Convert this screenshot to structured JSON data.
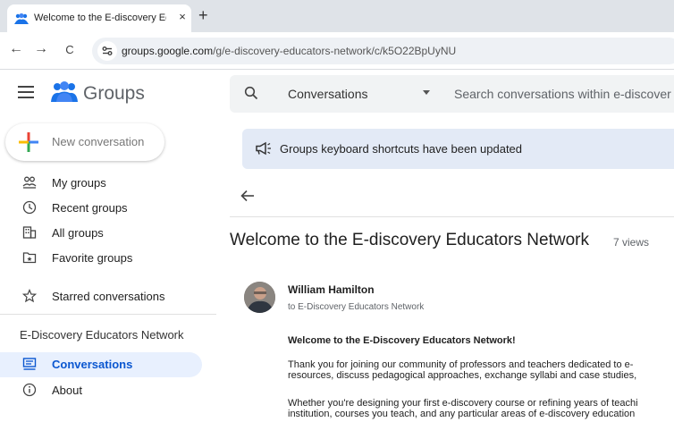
{
  "browser": {
    "tab_title": "Welcome to the E-discovery Ed",
    "tab_close": "×",
    "new_tab": "+",
    "back": "←",
    "forward": "→",
    "reload": "C",
    "url_host": "groups.google.com",
    "url_path": "/g/e-discovery-educators-network/c/k5O22BpUyNU"
  },
  "app": {
    "name": "Groups",
    "new_conversation": "New conversation"
  },
  "sidebar": {
    "items": [
      {
        "label": "My groups",
        "icon": "people-icon"
      },
      {
        "label": "Recent groups",
        "icon": "clock-icon"
      },
      {
        "label": "All groups",
        "icon": "building-icon"
      },
      {
        "label": "Favorite groups",
        "icon": "folder-star-icon"
      },
      {
        "label": "Starred conversations",
        "icon": "star-icon"
      }
    ],
    "group_name": "E-Discovery Educators Network",
    "group_items": [
      {
        "label": "Conversations",
        "icon": "chat-icon",
        "active": true
      },
      {
        "label": "About",
        "icon": "info-icon"
      }
    ]
  },
  "search": {
    "scope": "Conversations",
    "placeholder": "Search conversations within e-discover"
  },
  "banner": {
    "text": "Groups keyboard shortcuts have been updated"
  },
  "conversation": {
    "title": "Welcome to the E-discovery Educators Network",
    "views": "7 views",
    "author": "William Hamilton",
    "recipient": "to E-Discovery Educators Network",
    "message_heading": "Welcome to the E-Discovery Educators Network!",
    "paragraph1_line1": "Thank you for joining our community of professors and teachers dedicated to e-",
    "paragraph1_line2": "resources, discuss pedagogical approaches, exchange syllabi and case studies,",
    "paragraph2_line1": "Whether you're designing your first e-discovery course or refining years of teachi",
    "paragraph2_line2": "institution, courses you teach, and any particular areas of e-discovery education"
  },
  "colors": {
    "accent": "#0b57d0",
    "active_bg": "#e8f0fe",
    "banner_bg": "#e3eaf6"
  }
}
